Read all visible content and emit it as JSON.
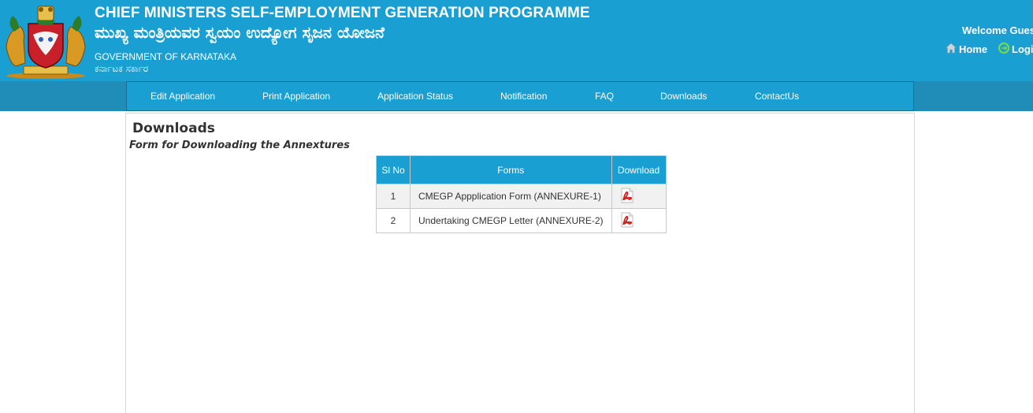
{
  "header": {
    "title_en": "CHIEF MINISTERS SELF-EMPLOYMENT GENERATION PROGRAMME",
    "title_kn": "ಮುಖ್ಯ ಮಂತ್ರಿಯವರ ಸ್ವಯಂ ಉದ್ಯೋಗ ಸೃಜನ ಯೋಜನೆ",
    "gov_en": "GOVERNMENT OF KARNATAKA",
    "gov_kn": "ಕರ್ನಾಟಕ ಸರ್ಕಾರ",
    "welcome_prefix": "Welcome",
    "welcome_user": "Guest",
    "home_label": "Home",
    "login_label": "Login"
  },
  "nav": {
    "items": [
      {
        "label": "Edit Application"
      },
      {
        "label": "Print Application"
      },
      {
        "label": "Application Status"
      },
      {
        "label": "Notification"
      },
      {
        "label": "FAQ"
      },
      {
        "label": "Downloads"
      },
      {
        "label": "ContactUs"
      }
    ]
  },
  "main": {
    "title": "Downloads",
    "subtitle": "Form for Downloading the Annextures",
    "table": {
      "headers": [
        "Sl No",
        "Forms",
        "Download"
      ],
      "rows": [
        {
          "sl": "1",
          "form": "CMEGP Appplication Form (ANNEXURE-1)",
          "icon": "pdf-icon"
        },
        {
          "sl": "2",
          "form": "Undertaking CMEGP Letter (ANNEXURE-2)",
          "icon": "pdf-icon"
        }
      ]
    }
  },
  "colors": {
    "header_bg": "#1a9fd3",
    "nav_strip": "#1f8db8",
    "table_header": "#1a9fd3",
    "pdf_red": "#d01f1f"
  }
}
